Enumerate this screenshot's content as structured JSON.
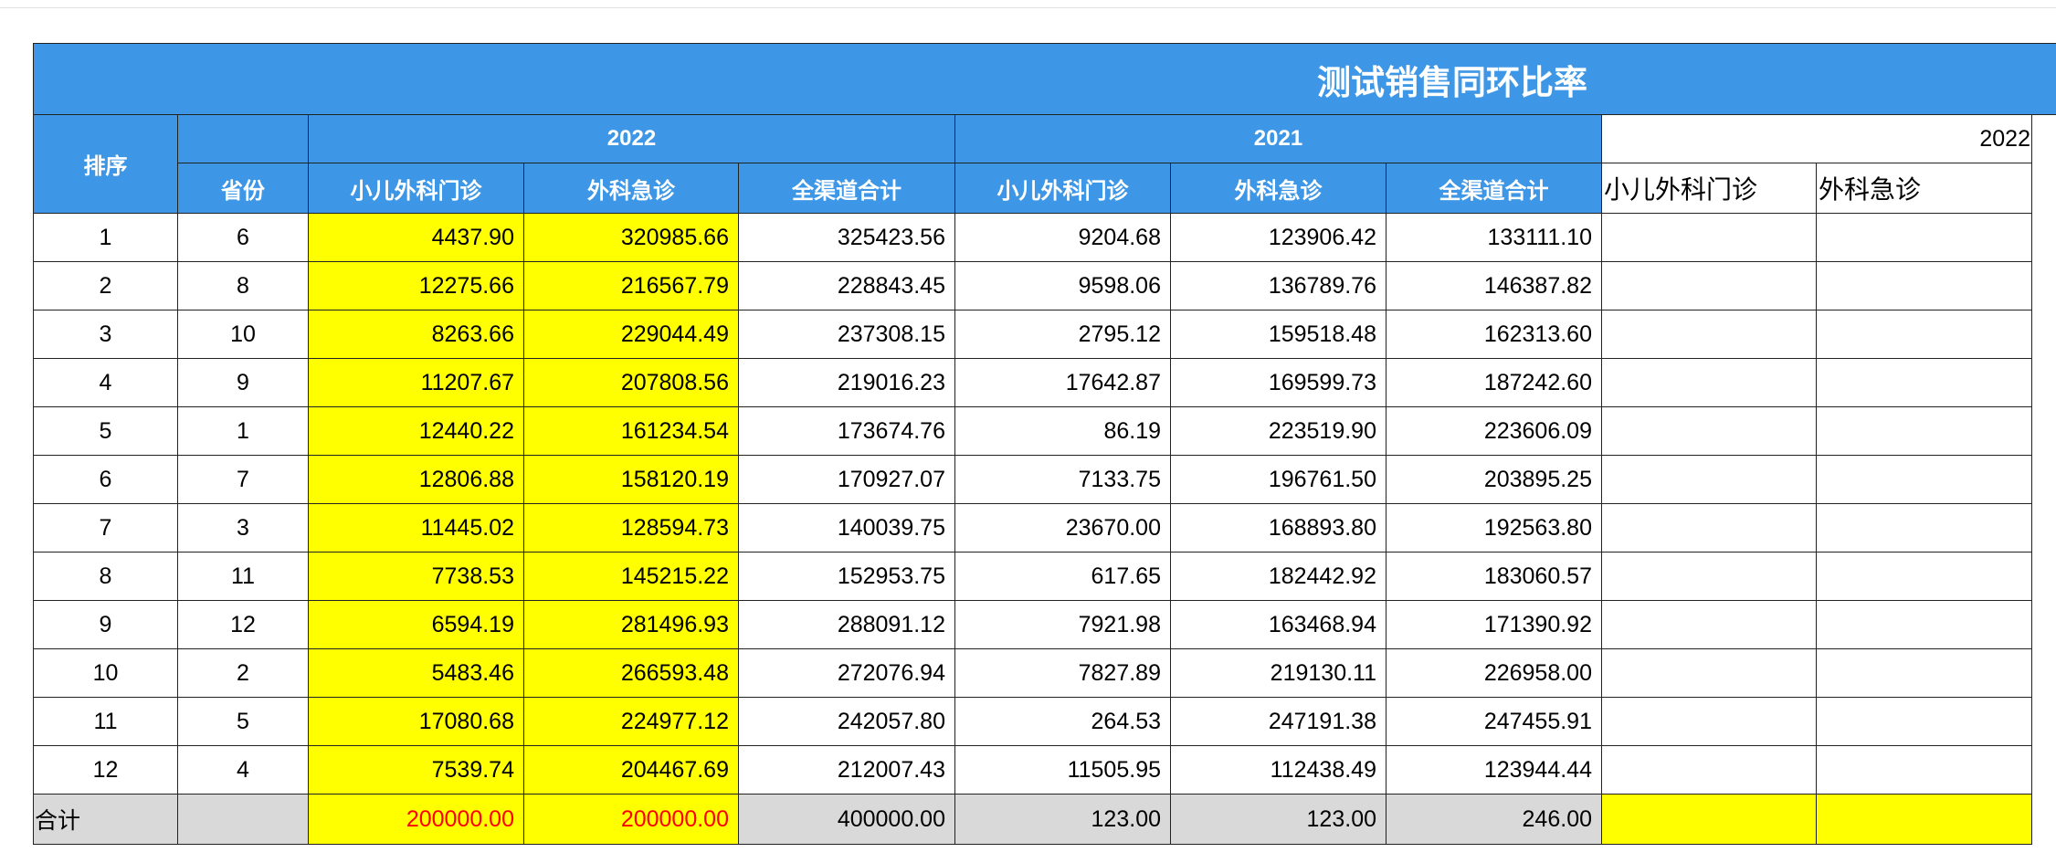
{
  "title": "测试销售同环比率",
  "header": {
    "rank": "排序",
    "province": "省份",
    "year_2022": "2022",
    "year_2021": "2021",
    "year_2022_right": "2022",
    "cols_2022": [
      "小儿外科门诊",
      "外科急诊",
      "全渠道合计"
    ],
    "cols_2021": [
      "小儿外科门诊",
      "外科急诊",
      "全渠道合计"
    ],
    "cols_right": [
      "小儿外科门诊",
      "外科急诊"
    ]
  },
  "rows": [
    {
      "rank": "1",
      "province": "6",
      "y2022": [
        "4437.90",
        "320985.66",
        "325423.56"
      ],
      "y2021": [
        "9204.68",
        "123906.42",
        "133111.10"
      ]
    },
    {
      "rank": "2",
      "province": "8",
      "y2022": [
        "12275.66",
        "216567.79",
        "228843.45"
      ],
      "y2021": [
        "9598.06",
        "136789.76",
        "146387.82"
      ]
    },
    {
      "rank": "3",
      "province": "10",
      "y2022": [
        "8263.66",
        "229044.49",
        "237308.15"
      ],
      "y2021": [
        "2795.12",
        "159518.48",
        "162313.60"
      ]
    },
    {
      "rank": "4",
      "province": "9",
      "y2022": [
        "11207.67",
        "207808.56",
        "219016.23"
      ],
      "y2021": [
        "17642.87",
        "169599.73",
        "187242.60"
      ]
    },
    {
      "rank": "5",
      "province": "1",
      "y2022": [
        "12440.22",
        "161234.54",
        "173674.76"
      ],
      "y2021": [
        "86.19",
        "223519.90",
        "223606.09"
      ]
    },
    {
      "rank": "6",
      "province": "7",
      "y2022": [
        "12806.88",
        "158120.19",
        "170927.07"
      ],
      "y2021": [
        "7133.75",
        "196761.50",
        "203895.25"
      ]
    },
    {
      "rank": "7",
      "province": "3",
      "y2022": [
        "11445.02",
        "128594.73",
        "140039.75"
      ],
      "y2021": [
        "23670.00",
        "168893.80",
        "192563.80"
      ]
    },
    {
      "rank": "8",
      "province": "11",
      "y2022": [
        "7738.53",
        "145215.22",
        "152953.75"
      ],
      "y2021": [
        "617.65",
        "182442.92",
        "183060.57"
      ]
    },
    {
      "rank": "9",
      "province": "12",
      "y2022": [
        "6594.19",
        "281496.93",
        "288091.12"
      ],
      "y2021": [
        "7921.98",
        "163468.94",
        "171390.92"
      ]
    },
    {
      "rank": "10",
      "province": "2",
      "y2022": [
        "5483.46",
        "266593.48",
        "272076.94"
      ],
      "y2021": [
        "7827.89",
        "219130.11",
        "226958.00"
      ]
    },
    {
      "rank": "11",
      "province": "5",
      "y2022": [
        "17080.68",
        "224977.12",
        "242057.80"
      ],
      "y2021": [
        "264.53",
        "247191.38",
        "247455.91"
      ]
    },
    {
      "rank": "12",
      "province": "4",
      "y2022": [
        "7539.74",
        "204467.69",
        "212007.43"
      ],
      "y2021": [
        "11505.95",
        "112438.49",
        "123944.44"
      ]
    }
  ],
  "total": {
    "label": "合计",
    "y2022": [
      "200000.00",
      "200000.00",
      "400000.00"
    ],
    "y2021": [
      "123.00",
      "123.00",
      "246.00"
    ]
  },
  "colors": {
    "header_blue": "#3d97e6",
    "highlight_yellow": "#ffff00",
    "total_gray": "#d9d9d9",
    "total_red": "#ff0000"
  }
}
